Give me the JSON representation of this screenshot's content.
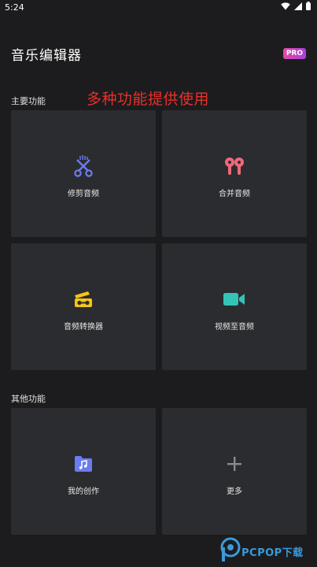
{
  "status_bar": {
    "time": "5:24",
    "icons": [
      "wifi-icon",
      "cellular-signal-icon",
      "battery-icon"
    ]
  },
  "header": {
    "title": "音乐编辑器",
    "badge": "PRO"
  },
  "annotation": "多种功能提供使用",
  "main_section": {
    "label": "主要功能",
    "items": [
      {
        "label": "修剪音频",
        "icon": "scissors-icon",
        "color": "#6b7cf0"
      },
      {
        "label": "合并音频",
        "icon": "earbuds-icon",
        "color": "#f06878"
      },
      {
        "label": "音频转换器",
        "icon": "converter-icon",
        "color": "#f5c516"
      },
      {
        "label": "视频至音频",
        "icon": "video-camera-icon",
        "color": "#33c4b6"
      }
    ]
  },
  "other_section": {
    "label": "其他功能",
    "items": [
      {
        "label": "我的创作",
        "icon": "music-folder-icon",
        "color": "#6b7cf0"
      },
      {
        "label": "更多",
        "icon": "plus-icon",
        "color": "#8a8a8a"
      }
    ]
  },
  "watermark": {
    "brand": "PCPOP下载"
  }
}
